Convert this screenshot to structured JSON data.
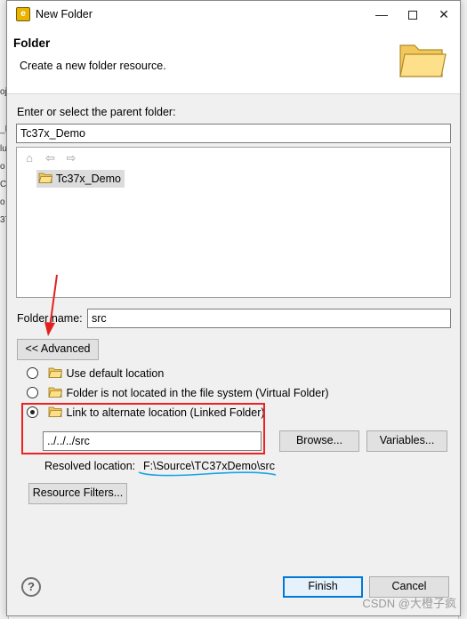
{
  "window": {
    "title": "New Folder"
  },
  "banner": {
    "title": "Folder",
    "description": "Create a new folder resource."
  },
  "parent_label": "Enter or select the parent folder:",
  "parent_input_value": "Tc37x_Demo",
  "tree": {
    "items": [
      {
        "label": "Tc37x_Demo",
        "selected": true
      }
    ]
  },
  "folder_name": {
    "label": "Folder name:",
    "value": "src"
  },
  "advanced_button": "<< Advanced",
  "location_options": [
    {
      "label": "Use default location",
      "selected": false
    },
    {
      "label": "Folder is not located in the file system (Virtual Folder)",
      "selected": false
    },
    {
      "label": "Link to alternate location (Linked Folder)",
      "selected": true
    }
  ],
  "link_location_value": "../../../src",
  "browse_button": "Browse...",
  "variables_button": "Variables...",
  "resolved": {
    "label": "Resolved location:",
    "value": "F:\\Source\\TC37xDemo\\src"
  },
  "resource_filters_button": "Resource Filters...",
  "finish_button": "Finish",
  "cancel_button": "Cancel",
  "watermark": "CSDN @大橙子疯",
  "background_glyphs": [
    "oj",
    "_I",
    "lu",
    "o",
    "Cc",
    "o",
    "37"
  ],
  "icons": [
    "app-icon",
    "minimize-icon",
    "maximize-icon",
    "close-icon",
    "folder-large-icon",
    "home-icon",
    "back-arrow-icon",
    "forward-arrow-icon",
    "folder-icon",
    "help-icon"
  ],
  "colors": {
    "accent": "#0078d7",
    "annotation_red": "#e22222",
    "annotation_blue": "#1aa3e8",
    "selection": "#dcdcdc"
  }
}
